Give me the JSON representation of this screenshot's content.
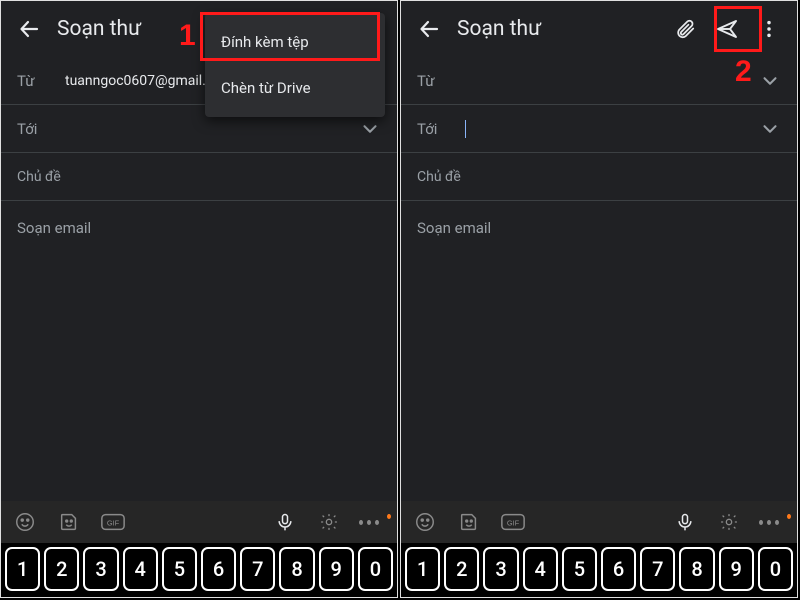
{
  "left": {
    "title": "Soạn thư",
    "from_label": "Từ",
    "from_value": "tuanngoc0607@gmail.co",
    "to_label": "Tới",
    "to_value": "",
    "subject_placeholder": "Chủ đề",
    "body_placeholder": "Soạn email",
    "menu": {
      "attach_file": "Đính kèm tệp",
      "insert_drive": "Chèn từ Drive"
    },
    "callout_number": "1"
  },
  "right": {
    "title": "Soạn thư",
    "from_label": "Từ",
    "from_value": "",
    "to_label": "Tới",
    "to_value": "",
    "subject_placeholder": "Chủ đề",
    "body_placeholder": "Soạn email",
    "callout_number": "2"
  },
  "keyboard": {
    "keys": [
      "1",
      "2",
      "3",
      "4",
      "5",
      "6",
      "7",
      "8",
      "9",
      "0"
    ]
  }
}
